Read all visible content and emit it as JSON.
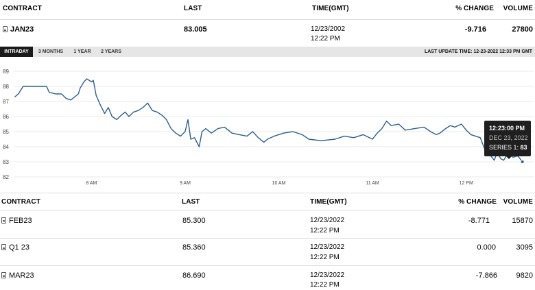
{
  "top_table": {
    "headers": {
      "contract": "CONTRACT",
      "last": "LAST",
      "time": "TIME(GMT)",
      "change": "% CHANGE",
      "volume": "VOLUME"
    },
    "row": {
      "contract": "JAN23",
      "last": "83.005",
      "date": "12/23/2002",
      "time": "12:22 PM",
      "change": "-9.716",
      "volume": "27800"
    }
  },
  "tabs": [
    "INTRADAY",
    "3 MONTHS",
    "1 YEAR",
    "2 YEARS"
  ],
  "active_tab": "INTRADAY",
  "last_update": "LAST UPDATE TIME: 12-23-2022 12:33 PM GMT",
  "tooltip": {
    "time": "12:23:00 PM",
    "date": "DEC 23, 2022",
    "series_label": "SERIES 1:",
    "series_value": "83"
  },
  "chart_data": {
    "type": "line",
    "x_ticks": [
      "8 AM",
      "9 AM",
      "10 AM",
      "11 AM",
      "12 PM"
    ],
    "y_ticks": [
      82,
      83,
      84,
      85,
      86,
      87,
      88,
      89
    ],
    "ylim": [
      82,
      89
    ],
    "xlim_hours": [
      7.17,
      12.72
    ],
    "color": "#2b5f8e",
    "grid": true,
    "series": [
      {
        "points": [
          [
            7.18,
            87.3
          ],
          [
            7.22,
            87.5
          ],
          [
            7.27,
            88.0
          ],
          [
            7.35,
            88.0
          ],
          [
            7.45,
            88.0
          ],
          [
            7.52,
            88.0
          ],
          [
            7.55,
            87.6
          ],
          [
            7.62,
            87.5
          ],
          [
            7.68,
            87.5
          ],
          [
            7.73,
            87.2
          ],
          [
            7.78,
            87.1
          ],
          [
            7.82,
            87.3
          ],
          [
            7.86,
            87.5
          ],
          [
            7.88,
            87.9
          ],
          [
            7.92,
            88.3
          ],
          [
            7.95,
            88.5
          ],
          [
            8.0,
            88.3
          ],
          [
            8.02,
            88.4
          ],
          [
            8.05,
            87.4
          ],
          [
            8.1,
            86.7
          ],
          [
            8.14,
            86.2
          ],
          [
            8.18,
            86.6
          ],
          [
            8.22,
            86.0
          ],
          [
            8.27,
            85.8
          ],
          [
            8.32,
            86.1
          ],
          [
            8.36,
            86.3
          ],
          [
            8.4,
            86.0
          ],
          [
            8.45,
            86.3
          ],
          [
            8.5,
            86.4
          ],
          [
            8.55,
            86.6
          ],
          [
            8.6,
            86.9
          ],
          [
            8.65,
            86.4
          ],
          [
            8.7,
            86.3
          ],
          [
            8.75,
            86.1
          ],
          [
            8.8,
            85.8
          ],
          [
            8.85,
            85.2
          ],
          [
            8.9,
            84.9
          ],
          [
            8.95,
            84.7
          ],
          [
            9.0,
            85.0
          ],
          [
            9.03,
            85.8
          ],
          [
            9.06,
            84.5
          ],
          [
            9.1,
            84.6
          ],
          [
            9.15,
            84.0
          ],
          [
            9.18,
            85.0
          ],
          [
            9.22,
            85.2
          ],
          [
            9.28,
            84.9
          ],
          [
            9.35,
            85.2
          ],
          [
            9.42,
            85.3
          ],
          [
            9.5,
            84.9
          ],
          [
            9.58,
            84.8
          ],
          [
            9.66,
            84.7
          ],
          [
            9.72,
            85.0
          ],
          [
            9.78,
            84.6
          ],
          [
            9.84,
            84.3
          ],
          [
            9.88,
            84.5
          ],
          [
            9.95,
            84.7
          ],
          [
            10.05,
            84.9
          ],
          [
            10.15,
            85.0
          ],
          [
            10.25,
            84.8
          ],
          [
            10.32,
            84.5
          ],
          [
            10.45,
            84.4
          ],
          [
            10.6,
            84.5
          ],
          [
            10.7,
            84.7
          ],
          [
            10.8,
            84.6
          ],
          [
            10.9,
            84.8
          ],
          [
            11.0,
            84.5
          ],
          [
            11.05,
            84.9
          ],
          [
            11.1,
            85.2
          ],
          [
            11.15,
            85.7
          ],
          [
            11.2,
            85.4
          ],
          [
            11.28,
            85.5
          ],
          [
            11.35,
            85.1
          ],
          [
            11.45,
            85.2
          ],
          [
            11.55,
            85.3
          ],
          [
            11.62,
            85.0
          ],
          [
            11.68,
            84.8
          ],
          [
            11.72,
            84.9
          ],
          [
            11.78,
            85.2
          ],
          [
            11.83,
            85.4
          ],
          [
            11.88,
            85.3
          ],
          [
            11.95,
            85.5
          ],
          [
            12.0,
            85.1
          ],
          [
            12.05,
            84.8
          ],
          [
            12.1,
            84.7
          ],
          [
            12.15,
            84.6
          ],
          [
            12.2,
            83.8
          ],
          [
            12.25,
            83.5
          ],
          [
            12.3,
            83.1
          ],
          [
            12.33,
            83.6
          ],
          [
            12.37,
            83.2
          ],
          [
            12.4,
            83.1
          ],
          [
            12.43,
            83.4
          ],
          [
            12.46,
            83.5
          ],
          [
            12.5,
            83.3
          ],
          [
            12.55,
            83.4
          ],
          [
            12.6,
            83.0
          ]
        ]
      }
    ],
    "highlight_point": [
      12.6,
      83.0
    ]
  },
  "bottom_table": {
    "headers": {
      "contract": "CONTRACT",
      "last": "LAST",
      "time": "TIME(GMT)",
      "change": "% CHANGE",
      "volume": "VOLUME"
    },
    "rows": [
      {
        "contract": "FEB23",
        "last": "85.300",
        "date": "12/23/2022",
        "time": "12:22 PM",
        "change": "-8.771",
        "volume": "15870"
      },
      {
        "contract": "Q1 23",
        "last": "85.360",
        "date": "12/23/2022",
        "time": "12:22 PM",
        "change": "0.000",
        "volume": "3095"
      },
      {
        "contract": "MAR23",
        "last": "86.690",
        "date": "12/23/2022",
        "time": "12:22 PM",
        "change": "-7.866",
        "volume": "9820"
      }
    ]
  }
}
